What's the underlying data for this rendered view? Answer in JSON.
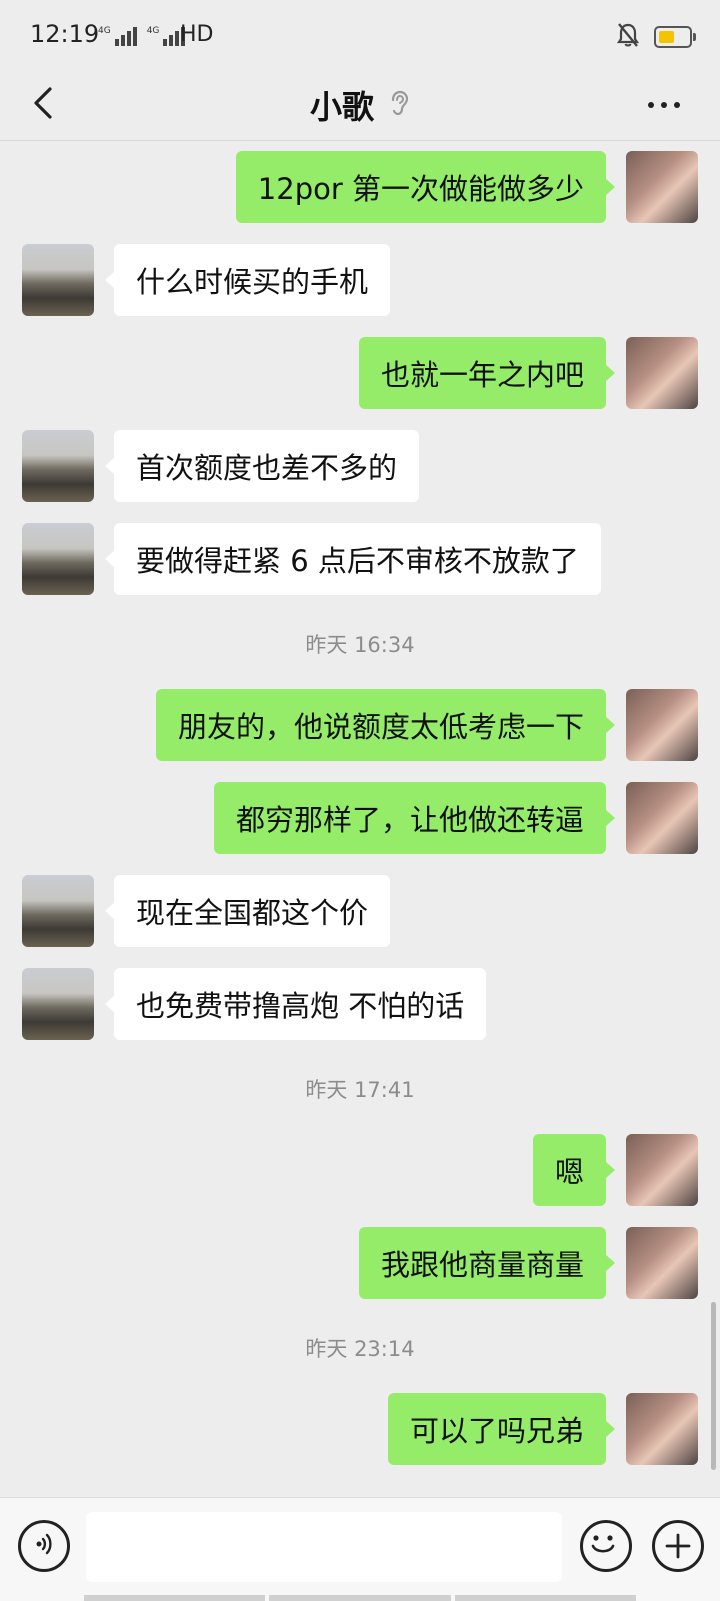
{
  "status_bar": {
    "time": "12:19",
    "network_tag_1": "4G",
    "network_tag_2": "4G",
    "hd_label": "HD",
    "icons": [
      "signal-icon",
      "signal-icon",
      "mute-icon",
      "battery-icon"
    ],
    "battery_color": "#f5c400"
  },
  "header": {
    "title": "小歌",
    "back_icon": "chevron-left-icon",
    "ear_icon": "ear-icon",
    "more_icon": "more-dots-icon"
  },
  "colors": {
    "outgoing_bubble": "#95ec69",
    "incoming_bubble": "#ffffff",
    "background": "#ededed"
  },
  "messages": [
    {
      "type": "msg",
      "side": "out",
      "text": "12por 第一次做能做多少"
    },
    {
      "type": "msg",
      "side": "in",
      "text": "什么时候买的手机"
    },
    {
      "type": "msg",
      "side": "out",
      "text": "也就一年之内吧"
    },
    {
      "type": "msg",
      "side": "in",
      "text": "首次额度也差不多的"
    },
    {
      "type": "msg",
      "side": "in",
      "text": "要做得赶紧 6 点后不审核不放款了"
    },
    {
      "type": "time",
      "text": "昨天 16:34"
    },
    {
      "type": "msg",
      "side": "out",
      "text": "朋友的，他说额度太低考虑一下"
    },
    {
      "type": "msg",
      "side": "out",
      "text": "都穷那样了，让他做还转逼"
    },
    {
      "type": "msg",
      "side": "in",
      "text": "现在全国都这个价"
    },
    {
      "type": "msg",
      "side": "in",
      "text": "也免费带撸高炮 不怕的话"
    },
    {
      "type": "time",
      "text": "昨天 17:41"
    },
    {
      "type": "msg",
      "side": "out",
      "text": "嗯"
    },
    {
      "type": "msg",
      "side": "out",
      "text": "我跟他商量商量"
    },
    {
      "type": "time",
      "text": "昨天 23:14"
    },
    {
      "type": "msg",
      "side": "out",
      "text": "可以了吗兄弟"
    }
  ],
  "input_bar": {
    "value": "",
    "voice_icon": "voice-icon",
    "emoji_icon": "emoji-icon",
    "plus_icon": "plus-icon"
  }
}
